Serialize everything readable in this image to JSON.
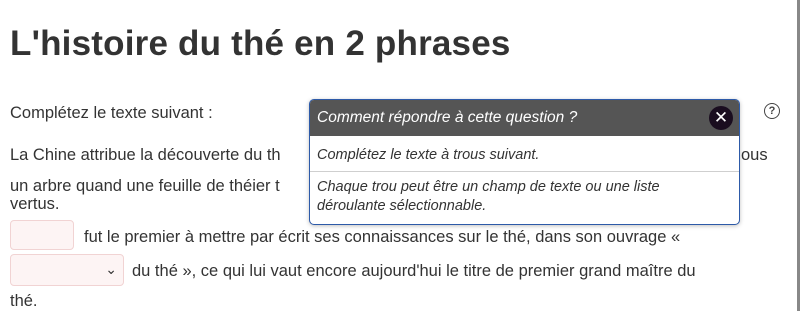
{
  "page": {
    "title": "L'histoire du thé en 2 phrases",
    "instruction": "Complétez le texte suivant :",
    "help_icon": "question-circle-icon",
    "paragraph": {
      "line1_start": "La Chine attribue la découverte du th",
      "line1_end": "ous",
      "line2": "un arbre quand une feuille de théier t",
      "line3": "vertus.",
      "line4": "fut le premier à mettre par écrit ses connaissances sur le thé, dans son ouvrage «",
      "line5": "du thé », ce qui lui vaut encore aujourd'hui le titre de premier grand maître du",
      "line6": "thé."
    },
    "blank_input": {
      "value": ""
    },
    "blank_select": {
      "selected": "",
      "icon": "chevron-down-icon"
    }
  },
  "popup": {
    "title": "Comment répondre à cette question ?",
    "close_icon": "close-icon",
    "text1": "Complétez le texte à trous suivant.",
    "text2_line1": "Chaque trou peut être un champ de texte ou une liste",
    "text2_line2": "déroulante sélectionnable."
  },
  "colors": {
    "popup_header": "#555555",
    "popup_border": "#2d5aa8",
    "blank_fill": "#fdf4f4"
  }
}
